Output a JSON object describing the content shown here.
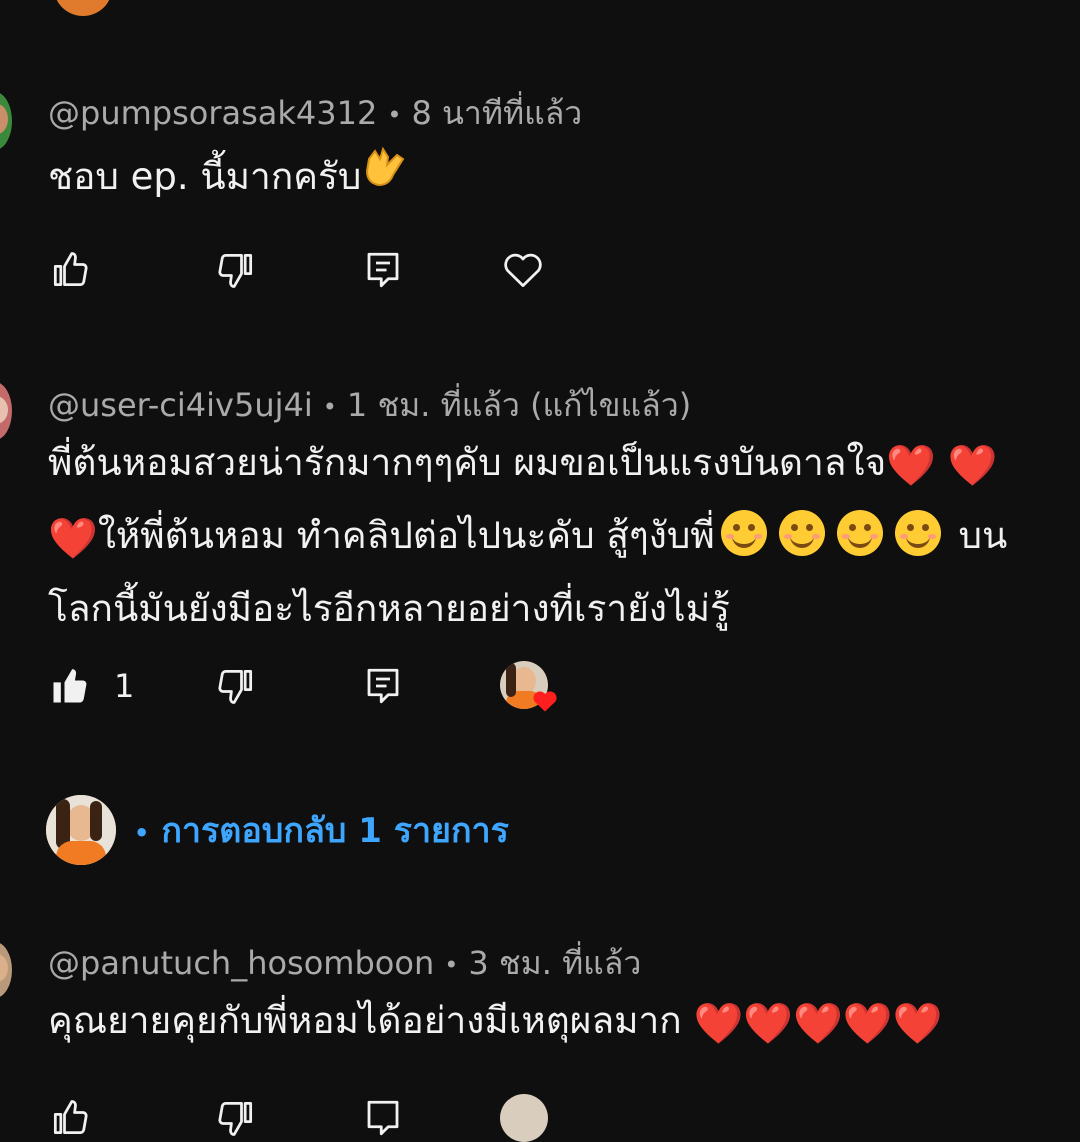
{
  "comments": [
    {
      "author": "@pumpsorasak4312",
      "time": "8 นาทีที่แล้ว",
      "text": "ชอบ ep. นี้มากครับ",
      "likes": ""
    },
    {
      "author": "@user-ci4iv5uj4i",
      "time": "1 ชม. ที่แล้ว (แก้ไขแล้ว)",
      "text_line1": "พี่ต้นหอมสวยน่ารักมากๆๆคับ ผมขอเป็นแรงบันดาลใจ",
      "text_line2": "ให้พี่ต้นหอม ทำคลิปต่อไปนะคับ สู้ๆงับพี่",
      "text_line2_end": "บน",
      "text_line3": "โลกนี้มันยังมีอะไรอีกหลายอย่างที่เรายังไม่รู้",
      "likes": "1",
      "replies_label": "การตอบกลับ 1 รายการ"
    },
    {
      "author": "@panutuch_hosomboon",
      "time": "3 ชม. ที่แล้ว",
      "text": "คุณยายคุยกับพี่หอมได้อย่างมีเหตุผลมาก"
    }
  ],
  "separator": "•",
  "colors": {
    "background": "#0f0f0f",
    "meta": "#aaaaaa",
    "link": "#3ea6ff",
    "heart": "#ff2a2a"
  },
  "icons": [
    "like-icon",
    "dislike-icon",
    "reply-icon",
    "heart-icon"
  ]
}
